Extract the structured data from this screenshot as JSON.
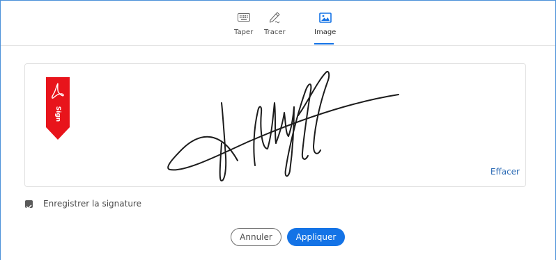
{
  "tabs": [
    {
      "label": "Taper",
      "icon": "keyboard-icon",
      "active": false
    },
    {
      "label": "Tracer",
      "icon": "pen-draw-icon",
      "active": false
    },
    {
      "label": "Image",
      "icon": "image-icon",
      "active": true
    }
  ],
  "signature_area": {
    "tag_text": "Sign",
    "clear_label": "Effacer"
  },
  "save_option": {
    "label": "Enregistrer la signature",
    "checked": true
  },
  "buttons": {
    "cancel_label": "Annuler",
    "apply_label": "Appliquer"
  },
  "colors": {
    "accent": "#1473e6",
    "tag_red": "#e8141b",
    "link": "#2c6bb5"
  }
}
